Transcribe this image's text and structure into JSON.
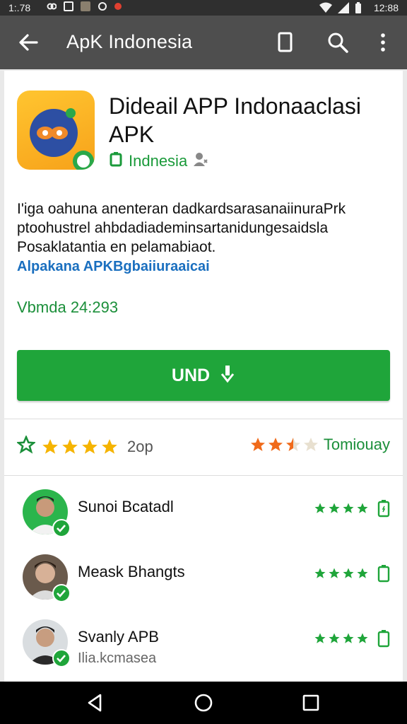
{
  "status_bar": {
    "time_left": "1:.78",
    "time_right": "12:88"
  },
  "app_bar": {
    "title": "ApK Indonesia"
  },
  "app": {
    "title": "Dideail APP Indonaaclasi APK",
    "developer": "Indnesia",
    "description": [
      "I'iga oahuna anenteran dadkardsarasanaiinuraPrk",
      "ptoohustrel ahbdadiademinsartanidungesaidsla",
      "Posaklatantia en pelamabiaot."
    ],
    "link": "Alpakana APKBgbaiiuraaicai",
    "version": "Vbmda 24:293"
  },
  "install_button": {
    "label": "UND"
  },
  "rating": {
    "count": "2op",
    "right_label": "Tomiouay",
    "left_stars": 4,
    "right_stars": 2.5
  },
  "reviews": [
    {
      "name": "Sunoi Bcatadl",
      "subtitle": "",
      "stars": 4
    },
    {
      "name": "Meask Bhangts",
      "subtitle": "",
      "stars": 4
    },
    {
      "name": "Svanly APB",
      "subtitle": "Ilia.kcmasea",
      "stars": 4
    }
  ],
  "colors": {
    "app_bar": "#4e4e4e",
    "status_bar": "#2f2f2f",
    "accent_green": "#1fa53a",
    "star_yellow": "#f5b400",
    "star_orange": "#f06a1a",
    "link_blue": "#1a6fbf"
  },
  "icons": {
    "back": "arrow-back-icon",
    "bookmark": "bookmark-icon",
    "search": "search-icon",
    "more": "more-vert-icon",
    "install": "download-icon",
    "verified": "verified-icon",
    "phone": "phone-icon",
    "person": "person-icon"
  }
}
